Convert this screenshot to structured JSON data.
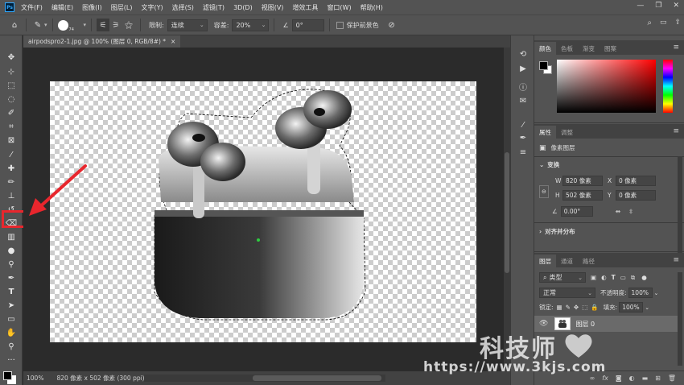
{
  "menubar": {
    "logo": "Ps",
    "items": [
      "文件(F)",
      "编辑(E)",
      "图像(I)",
      "图层(L)",
      "文字(Y)",
      "选择(S)",
      "滤镜(T)",
      "3D(D)",
      "视图(V)",
      "增效工具",
      "窗口(W)",
      "帮助(H)"
    ]
  },
  "options": {
    "brush_size": "74",
    "limit_label": "限制:",
    "limit_value": "连续",
    "tolerance_label": "容差:",
    "tolerance_value": "20%",
    "angle_value": "0°",
    "protect_label": "保护前景色"
  },
  "document": {
    "tab_title": "airpodspro2-1.jpg @ 100% (图层 0, RGB/8#) *",
    "close": "×"
  },
  "status": {
    "zoom": "100%",
    "info": "820 像素 x 502 像素 (300 ppi)"
  },
  "color_panel": {
    "tabs": [
      "颜色",
      "色板",
      "渐变",
      "图案"
    ]
  },
  "properties_panel": {
    "tabs": [
      "属性",
      "调整"
    ],
    "layer_type": "像素图层",
    "section_transform": "变换",
    "w_label": "W",
    "w_value": "820 像素",
    "x_label": "X",
    "x_value": "0 像素",
    "h_label": "H",
    "h_value": "502 像素",
    "y_label": "Y",
    "y_value": "0 像素",
    "angle_value": "0.00°",
    "section_align": "对齐并分布"
  },
  "layers_panel": {
    "tabs": [
      "图层",
      "通道",
      "路径"
    ],
    "filter_label": "类型",
    "blend_mode": "正常",
    "opacity_label": "不透明度:",
    "opacity_value": "100%",
    "lock_label": "锁定:",
    "fill_label": "填充:",
    "fill_value": "100%",
    "layer_name": "图层 0"
  },
  "watermark": {
    "title": "科技师",
    "url": "https://www.3kjs.com"
  },
  "colors": {
    "accent_red": "#e8262d",
    "ui_gray": "#535353"
  }
}
